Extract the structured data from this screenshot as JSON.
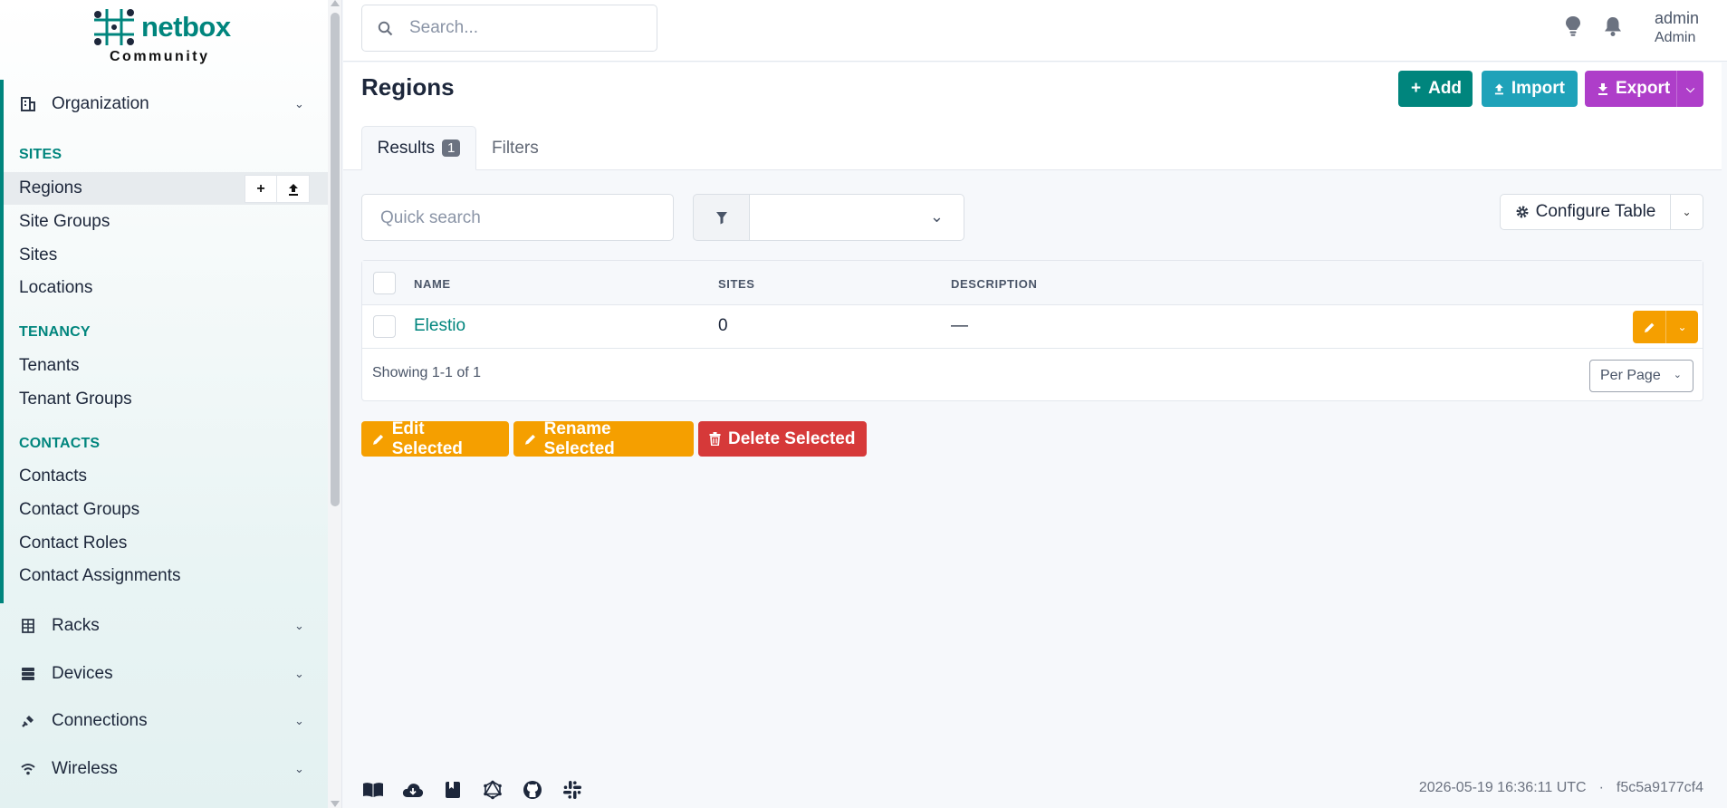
{
  "brand": {
    "name": "netbox",
    "edition": "Community"
  },
  "sidebar": {
    "organization": {
      "label": "Organization"
    },
    "groups": [
      {
        "title": "SITES",
        "items": [
          "Regions",
          "Site Groups",
          "Sites",
          "Locations"
        ]
      },
      {
        "title": "TENANCY",
        "items": [
          "Tenants",
          "Tenant Groups"
        ]
      },
      {
        "title": "CONTACTS",
        "items": [
          "Contacts",
          "Contact Groups",
          "Contact Roles",
          "Contact Assignments"
        ]
      }
    ],
    "active_item": "Regions",
    "active_item_actions": [
      "plus-icon",
      "upload-icon"
    ],
    "sections": [
      {
        "label": "Racks",
        "icon": "rack-icon"
      },
      {
        "label": "Devices",
        "icon": "server-icon"
      },
      {
        "label": "Connections",
        "icon": "plug-icon"
      },
      {
        "label": "Wireless",
        "icon": "wifi-icon"
      }
    ]
  },
  "header": {
    "search_placeholder": "Search...",
    "user": {
      "name": "admin",
      "role": "Admin"
    }
  },
  "page": {
    "title": "Regions",
    "actions": {
      "add": "Add",
      "import": "Import",
      "export": "Export"
    },
    "tabs": {
      "results": "Results",
      "results_count": "1",
      "filters": "Filters"
    }
  },
  "toolbar": {
    "quick_search_placeholder": "Quick search",
    "configure_table": "Configure Table"
  },
  "table": {
    "columns": [
      "NAME",
      "SITES",
      "DESCRIPTION"
    ],
    "rows": [
      {
        "name": "Elestio",
        "sites": "0",
        "description": "—"
      }
    ],
    "showing": "Showing 1-1 of 1",
    "per_page": "Per Page"
  },
  "bulk": {
    "edit": "Edit Selected",
    "rename": "Rename Selected",
    "delete": "Delete Selected"
  },
  "footer": {
    "icons": [
      "book-icon",
      "cloud-download-icon",
      "bookmark-icon",
      "graphql-icon",
      "github-icon",
      "slack-icon"
    ],
    "timestamp": "2026-05-19 16:36:11 UTC",
    "separator": "·",
    "commit": "f5c5a9177cf4"
  },
  "colors": {
    "primary": "#00857d",
    "cyan": "#1fa2b9",
    "purple": "#ae3ec9",
    "orange": "#f59f00",
    "red": "#d63939"
  }
}
